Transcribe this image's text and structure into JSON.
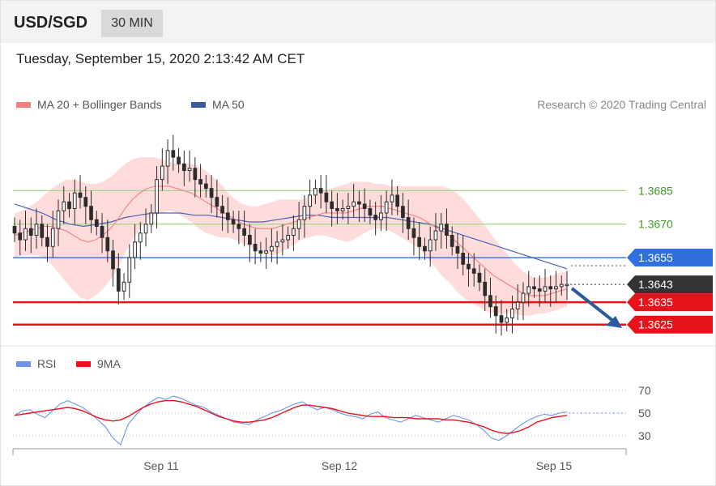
{
  "header": {
    "symbol": "USD/SGD",
    "timeframe": "30 MIN",
    "datetime": "Tuesday, September 15, 2020 2:13:42 AM CET"
  },
  "legend": {
    "ma20": "MA 20 + Bollinger Bands",
    "ma50": "MA 50",
    "rsi": "RSI",
    "rsi_ma": "9MA"
  },
  "credit": "Research © 2020 Trading Central",
  "colors": {
    "bands": "#ffd6d6",
    "ma20": "#f08080",
    "ma50": "#4a63b5",
    "resistance": "#a5d48a",
    "resistance_label": "#3f9b1e",
    "pivot": "#2f6fde",
    "support": "#e8121a",
    "last": "#333333",
    "arrow": "#2c5aa0",
    "candle": "#2c2c2c",
    "rsi": "#6f93e6",
    "rsi_ma": "#e8121a"
  },
  "chart_data": [
    {
      "type": "candlestick",
      "title": "USD/SGD",
      "x_ticks": [
        "Sep 11",
        "Sep 12",
        "Sep 15"
      ],
      "levels": [
        {
          "value": 1.3685,
          "label": "1.3685",
          "kind": "resistance"
        },
        {
          "value": 1.367,
          "label": "1.3670",
          "kind": "resistance"
        },
        {
          "value": 1.3655,
          "label": "1.3655",
          "kind": "pivot"
        },
        {
          "value": 1.3643,
          "label": "1.3643",
          "kind": "last"
        },
        {
          "value": 1.3635,
          "label": "1.3635",
          "kind": "support"
        },
        {
          "value": 1.3625,
          "label": "1.3625",
          "kind": "support"
        }
      ],
      "close": [
        1.3666,
        1.3663,
        1.3668,
        1.3665,
        1.367,
        1.3664,
        1.366,
        1.3668,
        1.3676,
        1.368,
        1.3677,
        1.3684,
        1.3682,
        1.3678,
        1.3672,
        1.3669,
        1.3664,
        1.3658,
        1.365,
        1.364,
        1.3644,
        1.3655,
        1.3662,
        1.3666,
        1.367,
        1.3675,
        1.369,
        1.3696,
        1.3703,
        1.37,
        1.3697,
        1.3694,
        1.3695,
        1.369,
        1.3688,
        1.3686,
        1.3682,
        1.3678,
        1.3675,
        1.3672,
        1.367,
        1.3668,
        1.3665,
        1.3661,
        1.3658,
        1.3657,
        1.3658,
        1.366,
        1.3662,
        1.3663,
        1.3665,
        1.3668,
        1.3672,
        1.3678,
        1.3683,
        1.3686,
        1.3684,
        1.368,
        1.3677,
        1.3676,
        1.3677,
        1.3678,
        1.368,
        1.3679,
        1.3677,
        1.3674,
        1.3672,
        1.3675,
        1.368,
        1.3683,
        1.3678,
        1.3673,
        1.3668,
        1.3664,
        1.366,
        1.3658,
        1.3663,
        1.3667,
        1.367,
        1.3665,
        1.366,
        1.3657,
        1.3652,
        1.365,
        1.3648,
        1.3644,
        1.3638,
        1.3633,
        1.3629,
        1.3626,
        1.3628,
        1.3632,
        1.3635,
        1.3639,
        1.3642,
        1.3641,
        1.364,
        1.3642,
        1.3641,
        1.3642,
        1.3643,
        1.3643
      ],
      "ma20": [
        1.3665,
        1.3666,
        1.3667,
        1.3668,
        1.3669,
        1.3669,
        1.3668,
        1.3667,
        1.3665,
        1.3663,
        1.3662,
        1.3663,
        1.3665,
        1.3668,
        1.3672,
        1.3677,
        1.3681,
        1.3684,
        1.3686,
        1.3687,
        1.3687,
        1.3687,
        1.3686,
        1.3685,
        1.3684,
        1.3682,
        1.368,
        1.3678,
        1.3676,
        1.3674,
        1.3672,
        1.367,
        1.3669,
        1.3668,
        1.3668,
        1.3668,
        1.3669,
        1.367,
        1.3671,
        1.3672,
        1.3673,
        1.3674,
        1.3675,
        1.3675,
        1.3675,
        1.3675,
        1.3676,
        1.3677,
        1.3678,
        1.3678,
        1.3678,
        1.3677,
        1.3676,
        1.3675,
        1.3674,
        1.3673,
        1.3671,
        1.3669,
        1.3667,
        1.3665,
        1.3662,
        1.3659,
        1.3656,
        1.3653,
        1.365,
        1.3647,
        1.3645,
        1.3643,
        1.3641,
        1.3639,
        1.3638,
        1.3638,
        1.3638,
        1.3639,
        1.364,
        1.3641
      ],
      "ma50": [
        1.3679,
        1.3677,
        1.3675,
        1.3672,
        1.367,
        1.3669,
        1.367,
        1.3671,
        1.3673,
        1.3674,
        1.3675,
        1.3675,
        1.3675,
        1.3674,
        1.3674,
        1.3673,
        1.3672,
        1.3671,
        1.3671,
        1.3672,
        1.3673,
        1.3674,
        1.3674,
        1.3673,
        1.3673,
        1.3673,
        1.3673,
        1.3673,
        1.3672,
        1.3671,
        1.367,
        1.3668,
        1.3666,
        1.3664,
        1.3662,
        1.366,
        1.3658,
        1.3656,
        1.3654,
        1.3652,
        1.365
      ],
      "ylim": [
        1.3618,
        1.3716
      ]
    },
    {
      "type": "line",
      "title": "RSI",
      "x_ticks": [
        "Sep 11",
        "Sep 12",
        "Sep 15"
      ],
      "y_ticks": [
        "70",
        "50",
        "30"
      ],
      "ylim": [
        20,
        80
      ],
      "series": [
        {
          "name": "RSI",
          "values": [
            48,
            52,
            53,
            49,
            46,
            52,
            58,
            61,
            58,
            55,
            50,
            44,
            38,
            28,
            22,
            40,
            48,
            55,
            60,
            64,
            62,
            65,
            63,
            60,
            57,
            55,
            51,
            48,
            45,
            42,
            41,
            40,
            44,
            47,
            50,
            52,
            55,
            58,
            60,
            56,
            53,
            55,
            53,
            50,
            48,
            47,
            45,
            49,
            51,
            46,
            44,
            42,
            45,
            48,
            46,
            44,
            42,
            45,
            48,
            46,
            44,
            40,
            35,
            28,
            26,
            30,
            35,
            40,
            44,
            47,
            49,
            48,
            50,
            51
          ]
        },
        {
          "name": "9MA",
          "values": [
            48,
            49,
            50,
            51,
            52,
            53,
            54,
            55,
            54,
            52,
            49,
            46,
            44,
            43,
            44,
            47,
            51,
            55,
            58,
            60,
            61,
            61,
            60,
            58,
            56,
            53,
            50,
            47,
            45,
            43,
            42,
            42,
            43,
            44,
            46,
            49,
            52,
            55,
            57,
            57,
            56,
            55,
            54,
            52,
            50,
            49,
            48,
            47,
            47,
            47,
            46,
            46,
            46,
            45,
            45,
            45,
            45,
            44,
            44,
            43,
            42,
            40,
            38,
            35,
            33,
            32,
            33,
            35,
            38,
            42,
            44,
            46,
            47,
            48
          ]
        }
      ]
    }
  ]
}
